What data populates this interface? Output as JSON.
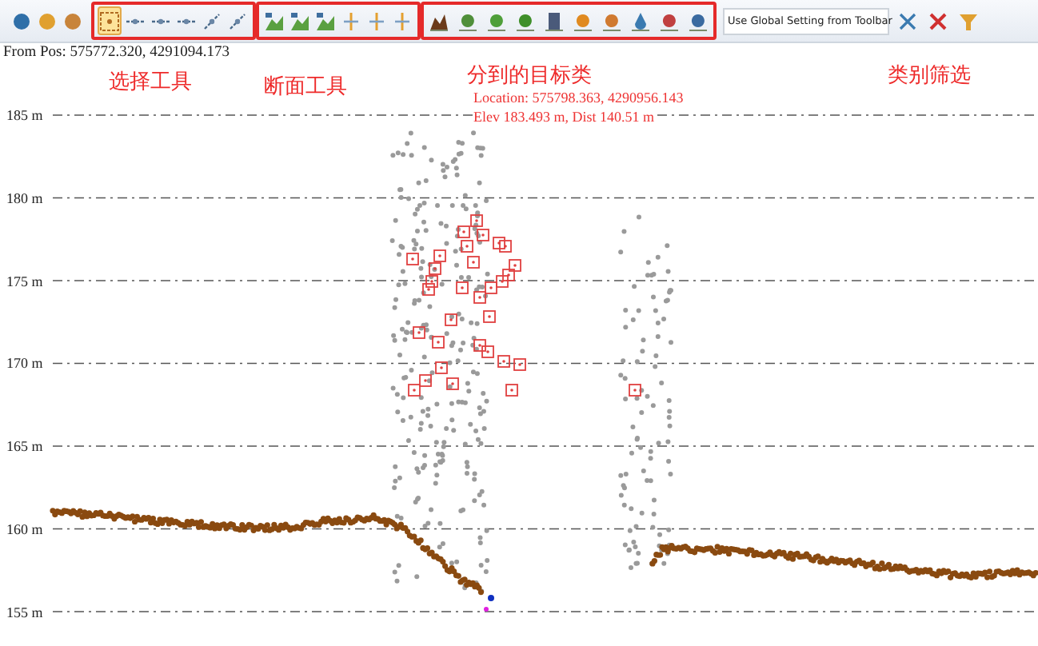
{
  "toolbar": {
    "groups": [
      {
        "annotated": false,
        "tools": [
          {
            "selected": false
          },
          {
            "selected": false
          },
          {
            "selected": false
          }
        ]
      },
      {
        "annotated": true,
        "tools": [
          {
            "selected": true
          },
          {
            "selected": false
          },
          {
            "selected": false
          },
          {
            "selected": false
          },
          {
            "selected": false
          },
          {
            "selected": false
          }
        ]
      },
      {
        "annotated": true,
        "tools": [
          {
            "selected": false
          },
          {
            "selected": false
          },
          {
            "selected": false
          },
          {
            "selected": false
          },
          {
            "selected": false
          },
          {
            "selected": false
          }
        ]
      },
      {
        "annotated": true,
        "tools": [
          {
            "selected": false
          },
          {
            "selected": false
          },
          {
            "selected": false
          },
          {
            "selected": false
          },
          {
            "selected": false
          },
          {
            "selected": false
          },
          {
            "selected": false
          },
          {
            "selected": false
          },
          {
            "selected": false
          },
          {
            "selected": false
          }
        ]
      }
    ],
    "dropdown": {
      "value": "Use Global Setting from Toolbar"
    },
    "trailing_tools": [
      {
        "selected": false
      },
      {
        "selected": false
      },
      {
        "selected": false
      }
    ]
  },
  "status": "From Pos: 575772.320, 4291094.173",
  "annotations": [
    "选择工具",
    "断面工具",
    "分到的目标类",
    "类别筛选"
  ],
  "profile": {
    "y_labels": [
      "185 m",
      "180 m",
      "175 m",
      "170 m",
      "165 m",
      "160 m",
      "155 m"
    ],
    "cursor_readout": [
      "Location: 575798.363, 4290956.143",
      "Elev 183.493 m, Dist 140.51 m"
    ]
  }
}
